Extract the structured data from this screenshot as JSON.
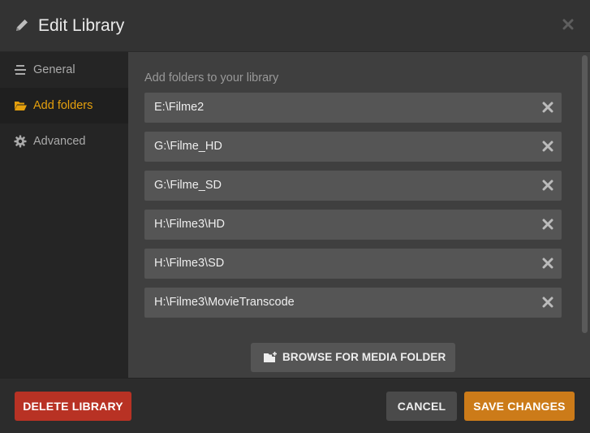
{
  "header": {
    "title": "Edit Library",
    "icon": "pencil-icon"
  },
  "sidebar": {
    "items": [
      {
        "label": "General",
        "icon": "general-icon",
        "active": false
      },
      {
        "label": "Add folders",
        "icon": "folder-open-icon",
        "active": true
      },
      {
        "label": "Advanced",
        "icon": "gear-icon",
        "active": false
      }
    ]
  },
  "main": {
    "label": "Add folders to your library",
    "folders": [
      "E:\\Filme2",
      "G:\\Filme_HD",
      "G:\\Filme_SD",
      "H:\\Filme3\\HD",
      "H:\\Filme3\\SD",
      "H:\\Filme3\\MovieTranscode"
    ],
    "browse_label": "BROWSE FOR MEDIA FOLDER"
  },
  "footer": {
    "delete_label": "DELETE LIBRARY",
    "cancel_label": "CANCEL",
    "save_label": "SAVE CHANGES"
  },
  "colors": {
    "accent": "#e5a00d",
    "delete": "#b83224",
    "save": "#cc7b19"
  }
}
